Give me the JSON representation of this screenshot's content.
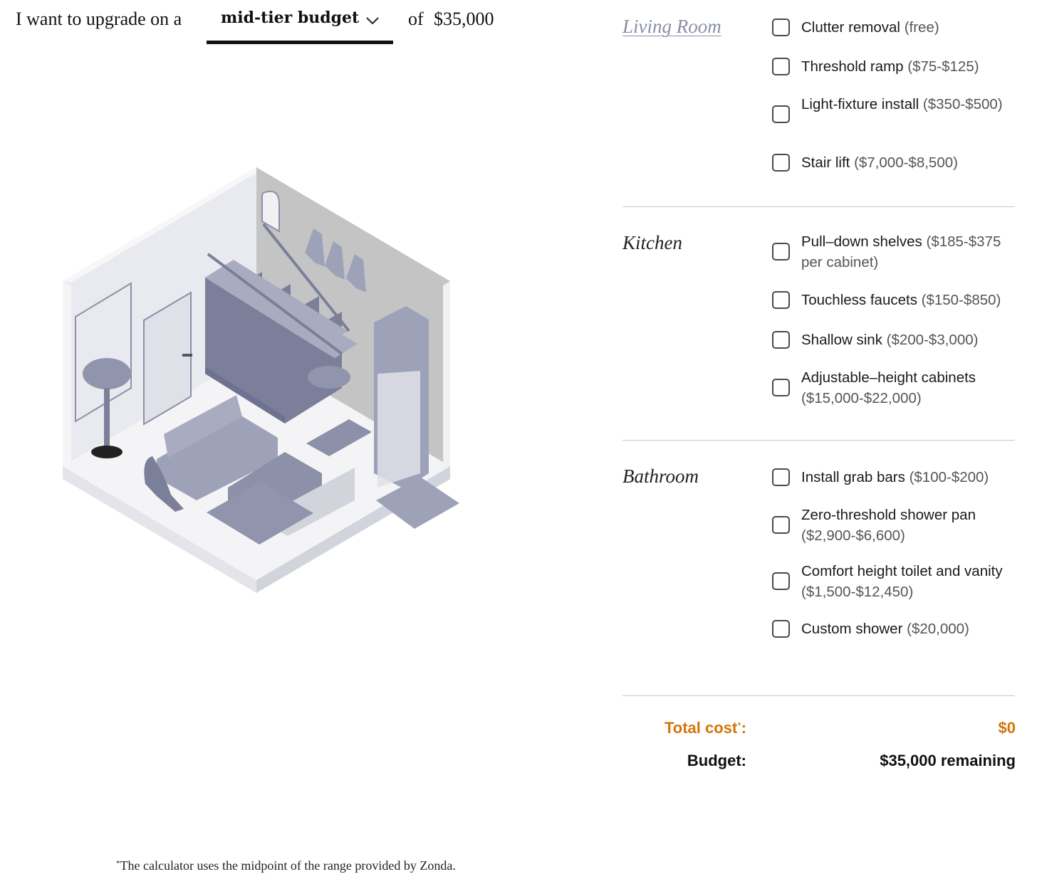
{
  "header": {
    "intro": "I want to upgrade on a",
    "tier": "mid-tier budget",
    "of": "of",
    "amount": "$35,000"
  },
  "sections": [
    {
      "name": "Living Room",
      "options": [
        {
          "label": "Clutter removal",
          "price": "(free)"
        },
        {
          "label": "Threshold ramp",
          "price": "($75-$125)"
        },
        {
          "label": "Light-fixture install",
          "price": "($350-$500)"
        },
        {
          "label": "Stair lift",
          "price": "($7,000-$8,500)"
        }
      ]
    },
    {
      "name": "Kitchen",
      "options": [
        {
          "label": "Pull–down shelves",
          "price": "($185-$375 per cabinet)"
        },
        {
          "label": "Touchless faucets",
          "price": "($150-$850)"
        },
        {
          "label": "Shallow sink",
          "price": "($200-$3,000)"
        },
        {
          "label": "Adjustable–height cabinets",
          "price": "($15,000-$22,000)"
        }
      ]
    },
    {
      "name": "Bathroom",
      "options": [
        {
          "label": "Install grab bars",
          "price": "($100-$200)"
        },
        {
          "label": "Zero-threshold shower pan",
          "price": "($2,900-$6,600)"
        },
        {
          "label": "Comfort height toilet and vanity",
          "price": "($1,500-$12,450)"
        },
        {
          "label": "Custom shower",
          "price": "($20,000)"
        }
      ]
    }
  ],
  "totals": {
    "total_label": "Total cost",
    "asterisk": "*",
    "colon": ":",
    "total_value": "$0",
    "budget_label": "Budget:",
    "budget_value": "$35,000 remaining"
  },
  "footnote": {
    "asterisk": "*",
    "text": "The calculator uses the midpoint of the range provided by Zonda."
  },
  "colors": {
    "accent": "#d4740a",
    "link": "#8a8ea6",
    "illustration": "#8c90a8"
  },
  "icons": {
    "dropdown": "chevron-down-icon",
    "checkbox": "checkbox-unchecked-icon"
  }
}
